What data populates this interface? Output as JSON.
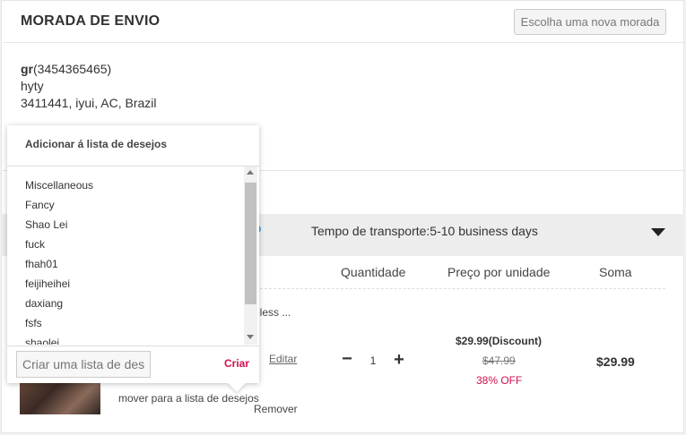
{
  "shipping": {
    "title": "MORADA DE ENVIO",
    "choose_button": "Escolha uma nova morada",
    "name": "gr",
    "phone": "(3454365465)",
    "line1": "hyty",
    "line2": "3411441, iyui, AC, Brazil"
  },
  "shipping_bar": {
    "time": "Tempo de transporte:5-10 business days",
    "toggle_icon": "caret-down-icon"
  },
  "columns": {
    "quantity": "Quantidade",
    "unit_price": "Preço por unidade",
    "sum": "Soma"
  },
  "product": {
    "name_fragment": "eless ...",
    "edit": "Editar",
    "move_to_wishlist": "mover para a lista de desejos",
    "remove": "Remover",
    "quantity": "1",
    "minus": "−",
    "plus": "+",
    "discount_price": "$29.99(Discount)",
    "original_price": "$47.99",
    "off": "38% OFF",
    "sum": "$29.99"
  },
  "wishlist_popup": {
    "title": "Adicionar á lista de desejos",
    "items": [
      "Miscellaneous",
      "Fancy",
      "Shao Lei",
      "fuck",
      "fhah01",
      "feijiheihei",
      "daxiang",
      "fsfs",
      "shaolei"
    ],
    "new_list_placeholder": "Criar uma lista de desejos",
    "create_button": "Criar"
  },
  "colors": {
    "accent": "#d0104c",
    "bar_bg": "#ededed"
  }
}
